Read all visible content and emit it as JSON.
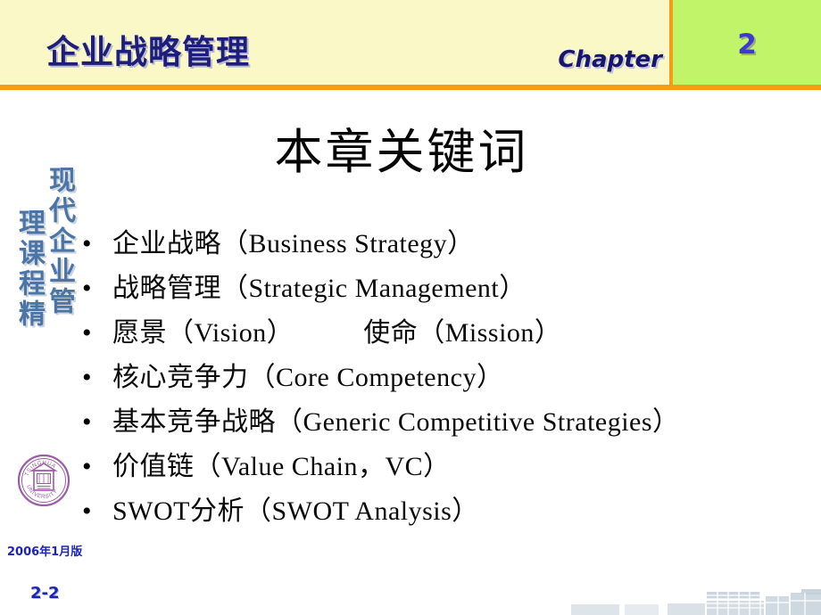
{
  "header": {
    "title": "企业战略管理",
    "chapter_label": "Chapter",
    "chapter_number": "2",
    "bg_color": "#fbf8c8",
    "accent_color": "#f79c18",
    "panel_color": "#c2f46a",
    "title_color": "#1d1d7a"
  },
  "slide": {
    "title": "本章关键词",
    "title_color": "#050505"
  },
  "bullets": [
    {
      "marker": "•",
      "text": "企业战略（Business Strategy）"
    },
    {
      "marker": "•",
      "text": "战略管理（Strategic Management）"
    },
    {
      "marker": "•",
      "text_a": "愿景（Vision）",
      "text_b": "使命（Mission）"
    },
    {
      "marker": "•",
      "text": "核心竞争力（Core Competency）"
    },
    {
      "marker": "•",
      "text": "基本竞争战略（Generic Competitive Strategies）"
    },
    {
      "marker": "•",
      "text": "价值链（Value Chain，VC）"
    },
    {
      "marker": "•",
      "text": "SWOT分析（SWOT Analysis）"
    }
  ],
  "watermark": {
    "column_right": "现代企业管",
    "column_left": "理课程精",
    "color": "#3d6a9e"
  },
  "seal": {
    "name": "tsinghua-university-seal",
    "text_top": "TSINGHUA",
    "text_bottom": "UNIVERSITY",
    "color": "#9b5ea6"
  },
  "footer": {
    "version": "2006年1月版",
    "page_number": "2-2",
    "color": "#1c23b8"
  },
  "decoration": {
    "name": "skyline-graphic",
    "color": "#b6c6d2"
  }
}
